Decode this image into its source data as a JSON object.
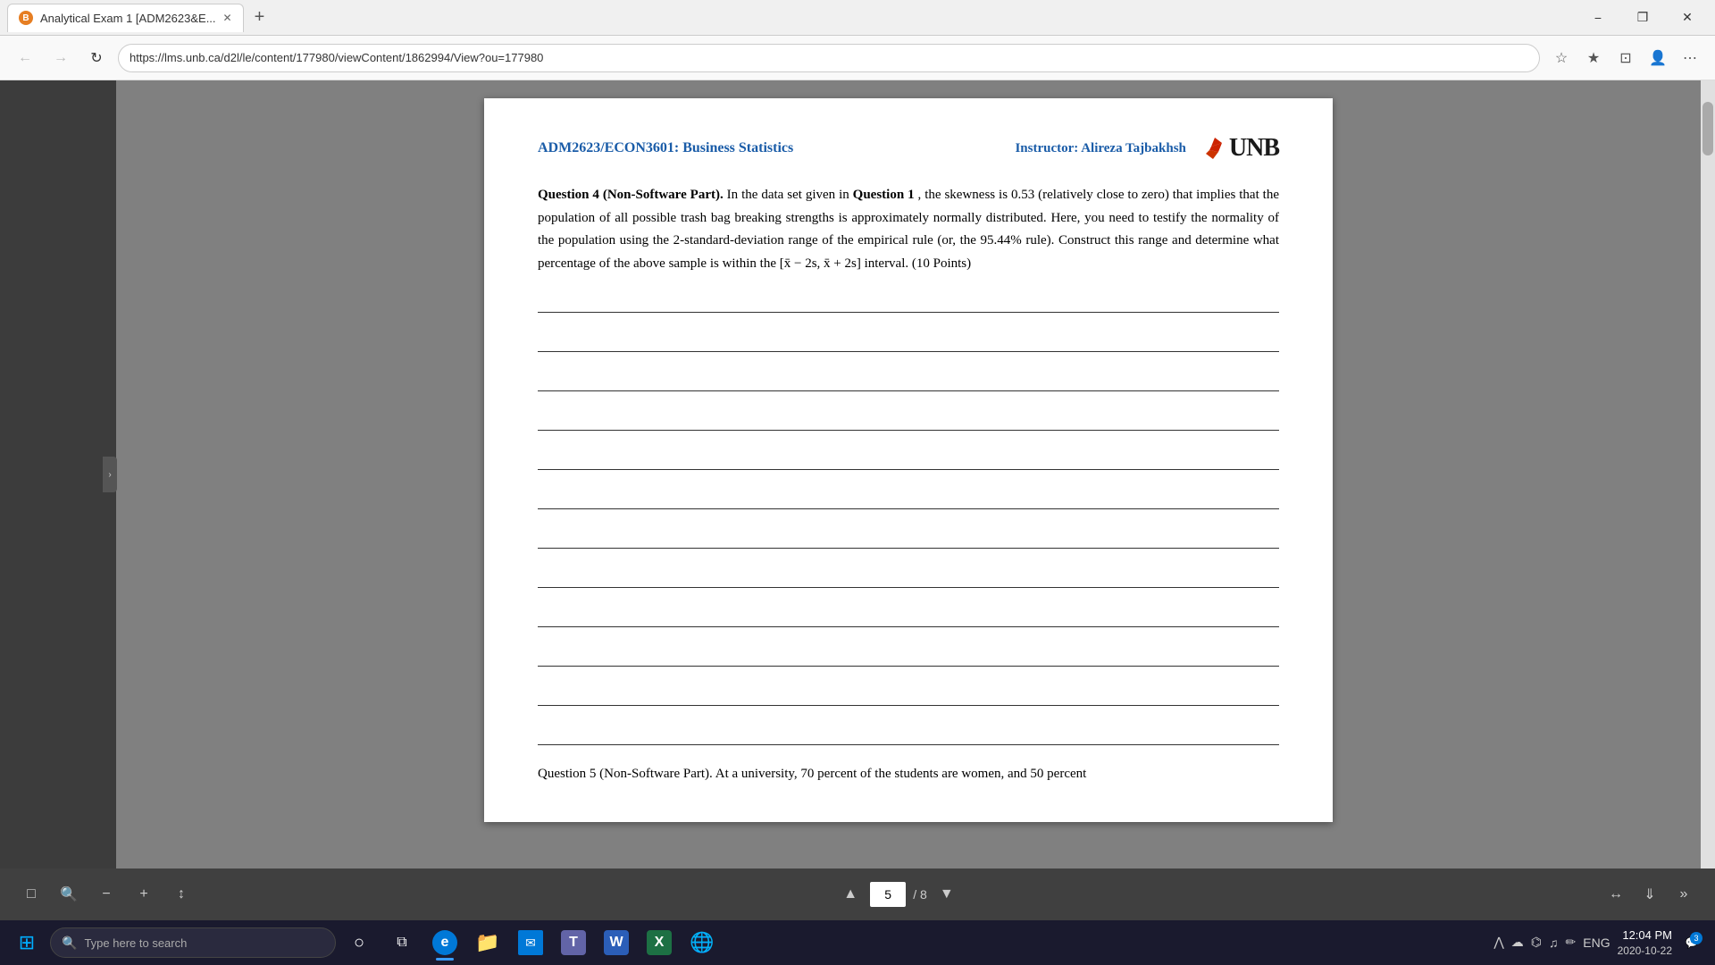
{
  "browser": {
    "tab": {
      "label": "Analytical Exam 1 [ADM2623&E...",
      "icon_color": "#e67e22"
    },
    "url": "https://lms.unb.ca/d2l/le/content/177980/viewContent/1862994/View?ou=177980",
    "window_controls": {
      "minimize": "−",
      "maximize": "❐",
      "close": "✕"
    }
  },
  "pdf": {
    "header": {
      "course": "ADM2623/ECON3601: Business Statistics",
      "instructor_label": "Instructor: Alireza Tajbakhsh",
      "logo": "UNB"
    },
    "question4": {
      "label": "Question 4 (Non-Software Part).",
      "text": " In the data set given in ",
      "q1_ref": "Question 1",
      "text2": ", the skewness is 0.53 (relatively close to zero) that implies that the population of all possible trash bag breaking strengths is approximately normally distributed. Here, you need to testify the normality of the population using the 2-standard-deviation range of the empirical rule (or, the 95.44% rule). Construct this range and determine what percentage of the above sample is within the [x̄ − 2s, x̄ + 2s] interval. (10 Points)"
    },
    "answer_line_count": 12,
    "question5_preview": {
      "label": "Question 5 (Non-Software Part).",
      "text": " At a university, 70 percent of the students are women, and 50 percent"
    },
    "toolbar": {
      "current_page": "5",
      "total_pages": "8",
      "of_label": "/ 8",
      "prev_label": "▲",
      "next_label": "▼",
      "zoom_in": "+",
      "zoom_out": "−",
      "sidebar_toggle": "▣",
      "search": "🔍",
      "fit_width": "⤢",
      "download": "⬇",
      "more": "»"
    }
  },
  "taskbar": {
    "search_placeholder": "Type here to search",
    "apps": [
      {
        "name": "windows-start",
        "icon": "⊞",
        "color": "#fff"
      },
      {
        "name": "cortana",
        "icon": "○",
        "color": "#fff"
      },
      {
        "name": "task-view",
        "icon": "⧉",
        "color": "#fff"
      },
      {
        "name": "edge-browser",
        "icon": "e",
        "color": "#0078d7",
        "active": true
      },
      {
        "name": "file-explorer",
        "icon": "📁",
        "color": "#e6a817",
        "active": false
      },
      {
        "name": "mail",
        "icon": "✉",
        "color": "#0078d7",
        "active": false
      },
      {
        "name": "teams",
        "icon": "T",
        "color": "#6264a7",
        "active": false
      },
      {
        "name": "word",
        "icon": "W",
        "color": "#2b5eb8",
        "active": false
      },
      {
        "name": "excel",
        "icon": "X",
        "color": "#1d7044",
        "active": false
      },
      {
        "name": "custom-app",
        "icon": "◈",
        "color": "#cc4444",
        "active": false
      }
    ],
    "system_tray": {
      "chevron": "^",
      "cloud": "☁",
      "wifi": "📶",
      "volume": "🔊",
      "pen": "✏"
    },
    "language": "ENG",
    "time": "12:04 PM",
    "date": "2020-10-22",
    "notification_count": "3"
  }
}
